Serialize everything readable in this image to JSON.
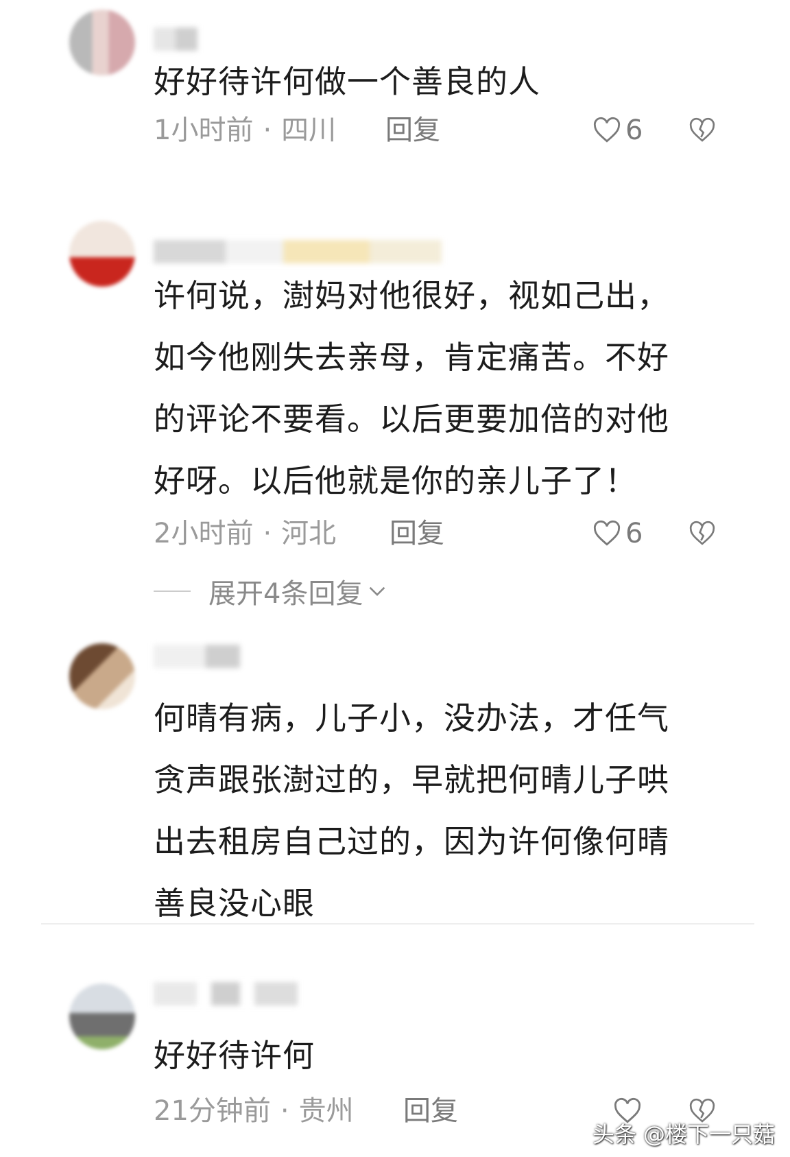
{
  "comments": [
    {
      "text": "好好待许何做一个善良的人",
      "time": "1小时前",
      "location": "四川",
      "reply_label": "回复",
      "likes": "6"
    },
    {
      "text": "许何说，澍妈对他很好，视如己出，\n如今他刚失去亲母，肯定痛苦。不好\n的评论不要看。以后更要加倍的对他\n好呀。以后他就是你的亲儿子了！",
      "time": "2小时前",
      "location": "河北",
      "reply_label": "回复",
      "likes": "6",
      "expand_label": "展开4条回复"
    },
    {
      "text": "何晴有病，儿子小，没办法，才任气\n贪声跟张澍过的，早就把何晴儿子哄\n出去租房自己过的，因为许何像何晴\n善良没心眼"
    },
    {
      "text": "好好待许何",
      "time": "21分钟前",
      "location": "贵州",
      "reply_label": "回复"
    }
  ],
  "meta_separator": "·",
  "watermark": "头条 @楼下一只菇",
  "colors": {
    "text": "#1c1c1c",
    "meta": "#9a9a9a",
    "action": "#7a7a7a"
  },
  "icons": {
    "like": "heart-outline-icon",
    "dislike": "broken-heart-icon",
    "expand": "chevron-down-icon"
  }
}
